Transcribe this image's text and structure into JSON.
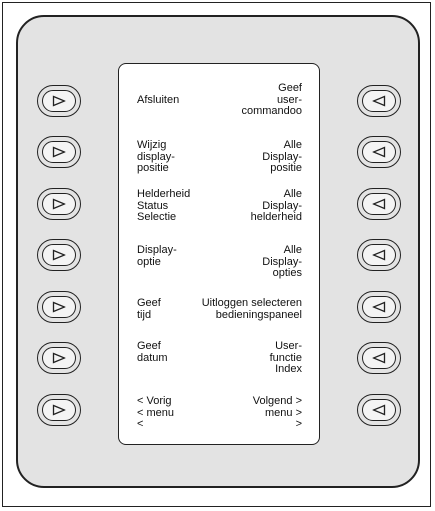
{
  "panel": {
    "left_items": [
      {
        "lines": [
          "Afsluiten"
        ]
      },
      {
        "lines": [
          "Wijzig",
          "display-",
          "positie"
        ]
      },
      {
        "lines": [
          "Helderheid",
          "Status",
          "Selectie"
        ]
      },
      {
        "lines": [
          "Display-",
          "optie"
        ]
      },
      {
        "lines": [
          "Geef",
          "tijd"
        ]
      },
      {
        "lines": [
          "Geef",
          "datum"
        ]
      },
      {
        "lines": [
          "< Vorig",
          "< menu",
          "<"
        ]
      }
    ],
    "right_items": [
      {
        "lines": [
          "Geef",
          "user-",
          "commandoo"
        ]
      },
      {
        "lines": [
          "Alle",
          "Display-",
          "positie"
        ]
      },
      {
        "lines": [
          "Alle",
          "Display-",
          "helderheid"
        ]
      },
      {
        "lines": [
          "Alle",
          "Display-",
          "opties"
        ]
      },
      {
        "lines": [
          "Uitloggen selecteren",
          "bedieningspaneel"
        ]
      },
      {
        "lines": [
          "User-",
          "functie",
          "Index"
        ]
      },
      {
        "lines": [
          "Volgend >",
          "menu >",
          ">"
        ]
      }
    ],
    "left_button_icon": "right-triangle-icon",
    "right_button_icon": "left-triangle-icon"
  }
}
